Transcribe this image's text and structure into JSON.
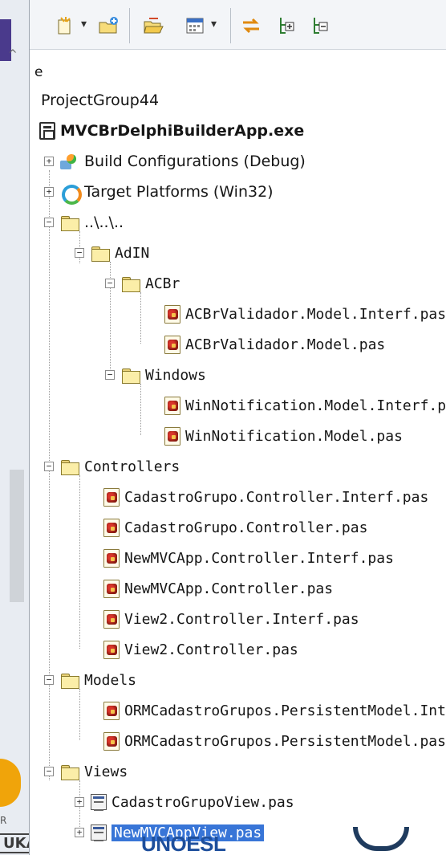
{
  "left_strip": {
    "label_r": "R",
    "label_ukao": "UKAO"
  },
  "toolbar": {
    "buttons": [
      {
        "icon": "new-item-icon"
      },
      {
        "icon": "dropdown-arrow-icon",
        "glyph": "▾"
      },
      {
        "icon": "add-folder-icon"
      },
      {
        "icon": "open-folder-icon"
      },
      {
        "icon": "calendar-view-icon"
      },
      {
        "icon": "dropdown-arrow-icon",
        "glyph": "▾"
      },
      {
        "icon": "sync-arrows-icon"
      },
      {
        "icon": "expand-tree-icon"
      },
      {
        "icon": "collapse-tree-icon"
      }
    ]
  },
  "tree": {
    "partial_label": "e",
    "project_group": "ProjectGroup44",
    "project": "MVCBrDelphiBuilderApp.exe",
    "build_configurations": "Build Configurations (Debug)",
    "target_platforms": "Target Platforms (Win32)",
    "root_folder": "..\\..\\..",
    "adin_folder": "AdIN",
    "acbr_folder": "ACBr",
    "acbr_files": [
      "ACBrValidador.Model.Interf.pas",
      "ACBrValidador.Model.pas"
    ],
    "windows_folder": "Windows",
    "windows_files": [
      "WinNotification.Model.Interf.pas",
      "WinNotification.Model.pas"
    ],
    "controllers_folder": "Controllers",
    "controllers_files": [
      "CadastroGrupo.Controller.Interf.pas",
      "CadastroGrupo.Controller.pas",
      "NewMVCApp.Controller.Interf.pas",
      "NewMVCApp.Controller.pas",
      "View2.Controller.Interf.pas",
      "View2.Controller.pas"
    ],
    "models_folder": "Models",
    "models_files": [
      "ORMCadastroGrupos.PersistentModel.Interf.pas",
      "ORMCadastroGrupos.PersistentModel.pas"
    ],
    "views_folder": "Views",
    "views_files": [
      "CadastroGrupoView.pas",
      "NewMVCAppView.pas"
    ]
  },
  "overlays": {
    "unoesl": "UNOESL"
  }
}
